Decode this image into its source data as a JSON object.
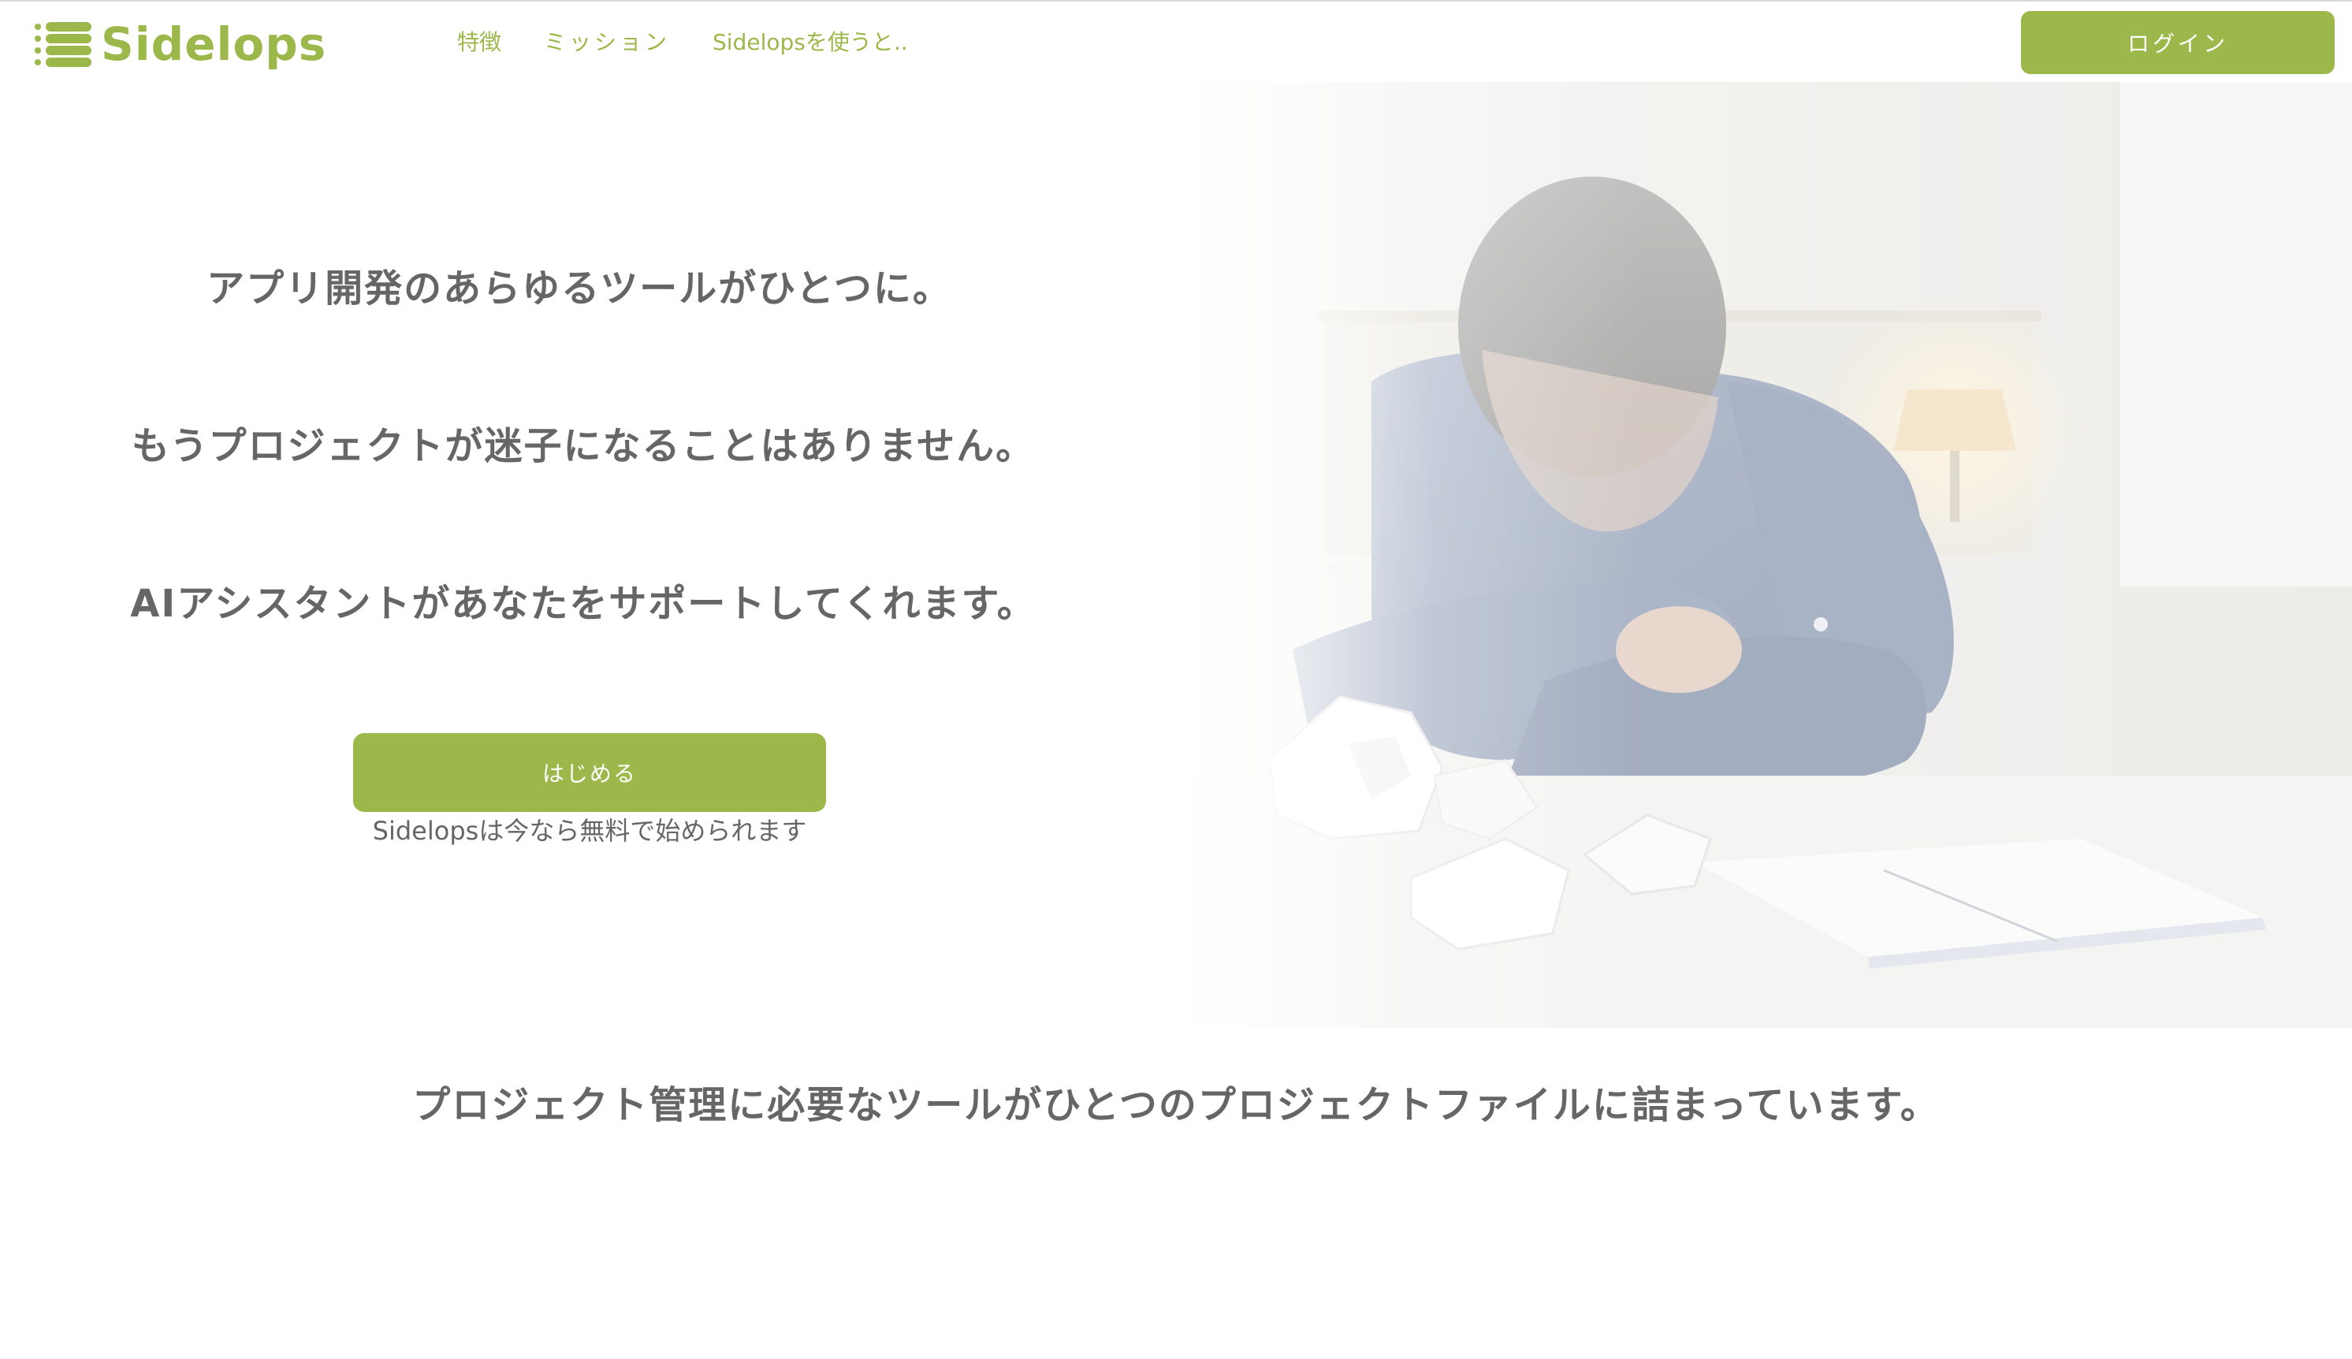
{
  "brand": {
    "name": "Sidelops",
    "logo_icon": "stacked-layers-icon",
    "accent_color": "#9db84a",
    "text_color": "#666666"
  },
  "nav": {
    "items": [
      {
        "label": "特徴"
      },
      {
        "label": "ミッション"
      },
      {
        "label": "Sidelopsを使うと.."
      }
    ],
    "login_label": "ログイン"
  },
  "hero": {
    "lines": [
      "アプリ開発のあらゆるツールがひとつに。",
      "もうプロジェクトが迷子になることはありません。",
      "AIアシスタントがあなたをサポートしてくれます。"
    ],
    "cta_label": "はじめる",
    "cta_note": "Sidelopsは今なら無料で始められます"
  },
  "features": {
    "heading": "プロジェクト管理に必要なツールがひとつのプロジェクトファイルに詰まっています。"
  }
}
